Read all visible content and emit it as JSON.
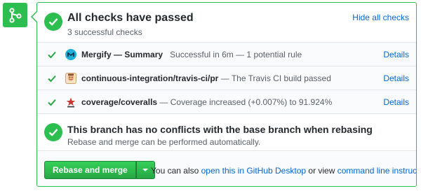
{
  "header": {
    "title": "All checks have passed",
    "subtitle": "3 successful checks",
    "hide_link": "Hide all checks"
  },
  "checks": [
    {
      "avatar_icon": "mergify-logo-icon",
      "name": "Mergify — Summary",
      "description": "Successful in 6m — 1 potential rule",
      "details": "Details"
    },
    {
      "avatar_icon": "travis-ci-logo-icon",
      "name": "continuous-integration/travis-ci/pr",
      "description": "— The Travis CI build passed",
      "details": "Details"
    },
    {
      "avatar_icon": "coveralls-logo-icon",
      "name": "coverage/coveralls",
      "description": "— Coverage increased (+0.007%) to 91.924%",
      "details": "Details"
    }
  ],
  "conflicts": {
    "title": "This branch has no conflicts with the base branch when rebasing",
    "subtitle": "Rebase and merge can be performed automatically."
  },
  "actions": {
    "merge_button": "Rebase and merge",
    "text_prefix": "You can also",
    "desktop_link": "open this in GitHub Desktop",
    "text_middle": "or view",
    "cli_link": "command line instructions",
    "text_suffix": "."
  },
  "colors": {
    "success_green": "#2cbe4e",
    "link_blue": "#0366d6",
    "muted_text": "#586069"
  }
}
